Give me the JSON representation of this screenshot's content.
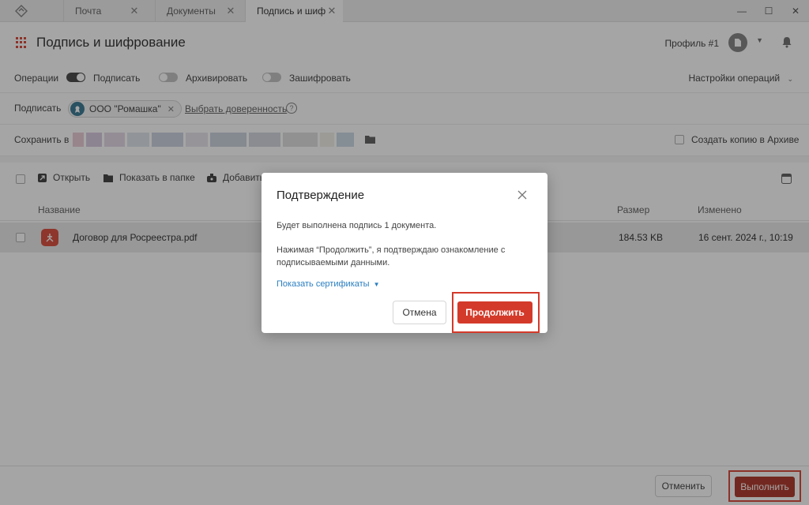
{
  "tabs": [
    {
      "label": "Почта"
    },
    {
      "label": "Документы"
    },
    {
      "label": "Подпись и шиф...",
      "active": true
    }
  ],
  "header": {
    "title": "Подпись и шифрование",
    "profile": "Профиль #1"
  },
  "operations": {
    "label": "Операции",
    "sign": {
      "label": "Подписать",
      "on": true
    },
    "archive": {
      "label": "Архивировать",
      "on": false
    },
    "encrypt": {
      "label": "Зашифровать",
      "on": false
    },
    "settings": "Настройки операций"
  },
  "signer": {
    "label": "Подписать",
    "org": "ООО \"Ромашка\"",
    "proxy_link": "Выбрать доверенность"
  },
  "save": {
    "label": "Сохранить в",
    "archive_copy": "Создать копию в Архиве"
  },
  "toolbar": {
    "open": "Открыть",
    "show_in_folder": "Показать в папке",
    "add": "Добавить"
  },
  "table": {
    "columns": {
      "name": "Название",
      "size": "Размер",
      "modified": "Изменено"
    },
    "rows": [
      {
        "name": "Договор для Росреестра.pdf",
        "size": "184.53 KB",
        "modified": "16 сент. 2024 г., 10:19"
      }
    ]
  },
  "footer": {
    "cancel": "Отменить",
    "run": "Выполнить"
  },
  "dialog": {
    "title": "Подтверждение",
    "text1": "Будет выполнена подпись 1 документа.",
    "text2": "Нажимая “Продолжить”, я подтверждаю ознакомление с подписываемыми данными.",
    "show_certs": "Показать сертификаты",
    "cancel": "Отмена",
    "continue": "Продолжить"
  },
  "colors": {
    "accent": "#d43a2a",
    "run_button": "#a8281b",
    "link": "#2a7fc1"
  }
}
